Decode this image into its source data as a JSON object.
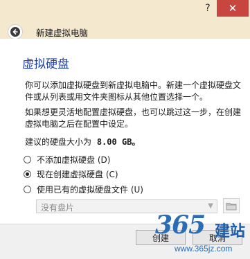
{
  "window": {
    "help_label": "?",
    "close_label": "✕"
  },
  "wizard": {
    "title": "新建虚拟电脑",
    "heading": "虚拟硬盘",
    "para1": "你可以添加虚拟硬盘到新虚拟电脑中。新建一个虚拟硬盘文件或从列表或用文件夹图标从其他位置选择一个。",
    "para2": "如果想更灵活地配置虚拟硬盘，也可以跳过这一步，在创建虚拟电脑之后在配置中设定。",
    "size_prefix": "建议的硬盘大小为",
    "size_value": "8.00 GB。"
  },
  "options": [
    {
      "label": "不添加虚拟硬盘 (D)",
      "selected": false
    },
    {
      "label": "现在创建虚拟硬盘 (C)",
      "selected": true
    },
    {
      "label": "使用已有的虚拟硬盘文件 (U)",
      "selected": false
    }
  ],
  "disk_select": {
    "value": "没有盘片"
  },
  "buttons": {
    "create": "创建",
    "cancel": "取消"
  },
  "watermark": {
    "numbers": "365",
    "text": "建站",
    "url": "www.365jz.com"
  },
  "colors": {
    "title_bg": "#f4e8cf",
    "close_bg": "#c7463f",
    "heading": "#1e3fa1"
  },
  "icons": {
    "back": "back-arrow-icon",
    "folder": "folder-icon",
    "dropdown": "chevron-down-icon"
  }
}
